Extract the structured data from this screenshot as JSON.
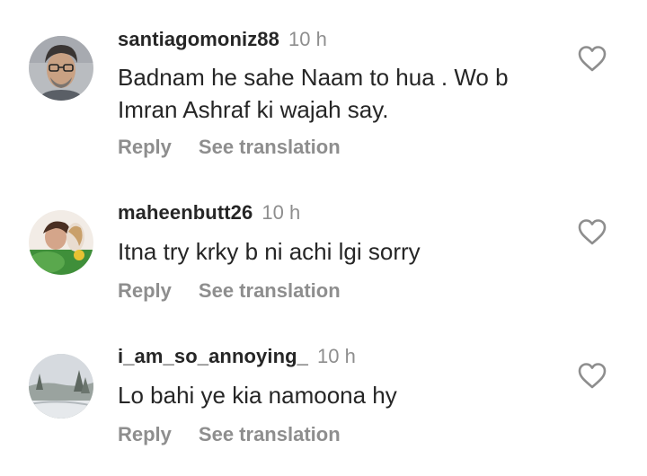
{
  "comments": [
    {
      "username": "santiagomoniz88",
      "time": "10 h",
      "text": "Badnam he sahe Naam to hua . Wo b\nImran Ashraf ki wajah say.",
      "reply_label": "Reply",
      "translate_label": "See translation",
      "like_icon": "heart-outline-icon"
    },
    {
      "username": "maheenbutt26",
      "time": "10 h",
      "text": "Itna try krky b ni achi lgi sorry",
      "reply_label": "Reply",
      "translate_label": "See translation",
      "like_icon": "heart-outline-icon"
    },
    {
      "username": "i_am_so_annoying_",
      "time": "10 h",
      "text": "Lo bahi ye kia namoona hy",
      "reply_label": "Reply",
      "translate_label": "See translation",
      "like_icon": "heart-outline-icon"
    }
  ],
  "colors": {
    "primary_text": "#262626",
    "secondary_text": "#8e8e8e",
    "icon": "#8e8e8e"
  }
}
